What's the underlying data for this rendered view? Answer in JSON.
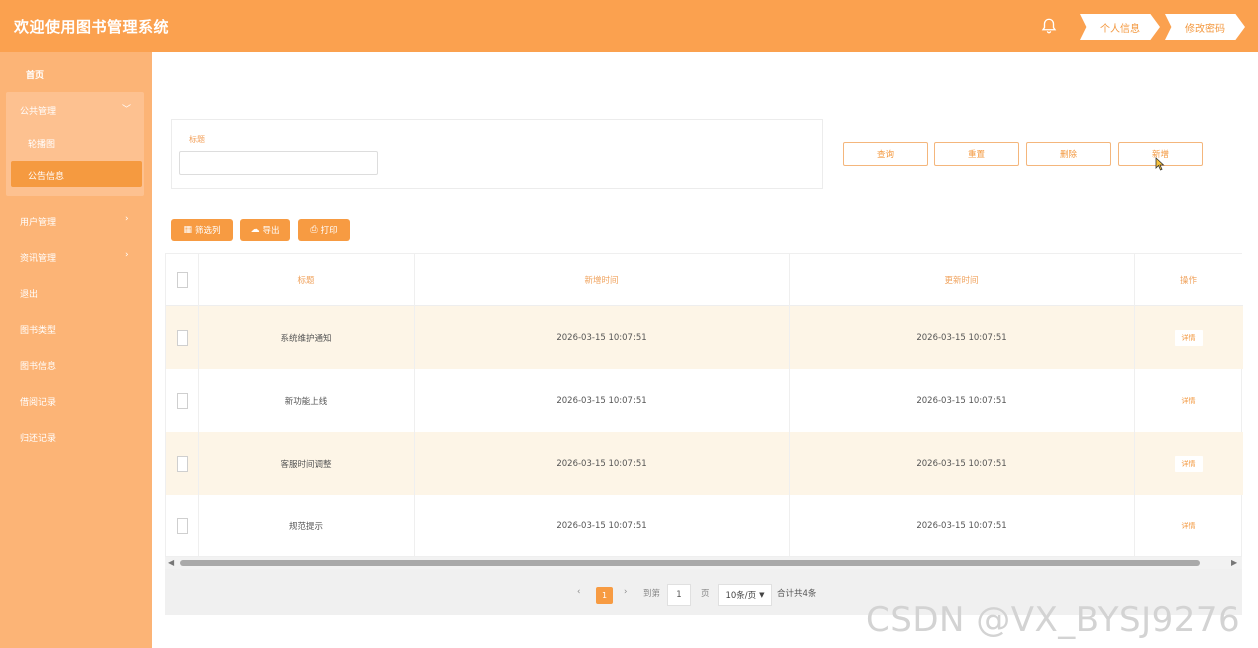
{
  "header": {
    "title": "欢迎使用图书管理系统",
    "bell_icon": "bell-icon",
    "profile_button": "个人信息",
    "password_button": "修改密码"
  },
  "sidebar": {
    "home": "首页",
    "public_group": "公共管理",
    "public_children": [
      "轮播图",
      "公告信息"
    ],
    "items": [
      "用户管理",
      "资讯管理",
      "退出",
      "图书类型",
      "图书信息",
      "借阅记录",
      "归还记录"
    ]
  },
  "search": {
    "label": "标题",
    "placeholder": ""
  },
  "actions": {
    "query": "查询",
    "reset": "重置",
    "delete": "删除",
    "add": "新增"
  },
  "tools": {
    "filter": "筛选列",
    "export": "导出",
    "print": "打印"
  },
  "table": {
    "columns": [
      "标题",
      "新增时间",
      "更新时间",
      "操作"
    ],
    "rows": [
      {
        "title": "系统维护通知",
        "created": "2026-03-15 10:07:51",
        "updated": "2026-03-15 10:07:51",
        "action": "详情"
      },
      {
        "title": "新功能上线",
        "created": "2026-03-15 10:07:51",
        "updated": "2026-03-15 10:07:51",
        "action": "详情"
      },
      {
        "title": "客服时间调整",
        "created": "2026-03-15 10:07:51",
        "updated": "2026-03-15 10:07:51",
        "action": "详情"
      },
      {
        "title": "规范提示",
        "created": "2026-03-15 10:07:51",
        "updated": "2026-03-15 10:07:51",
        "action": "详情"
      }
    ]
  },
  "pagination": {
    "current_page": "1",
    "goto_label": "到第",
    "goto_value": "1",
    "page_label": "页",
    "page_size": "10条/页",
    "total": "合计共4条"
  },
  "watermark": "CSDN @VX_BYSJ9276",
  "colors": {
    "brand": "#fba14f",
    "sidebar": "#fcb476",
    "accent": "#f79b42",
    "row_alt": "#fdf5e7"
  }
}
